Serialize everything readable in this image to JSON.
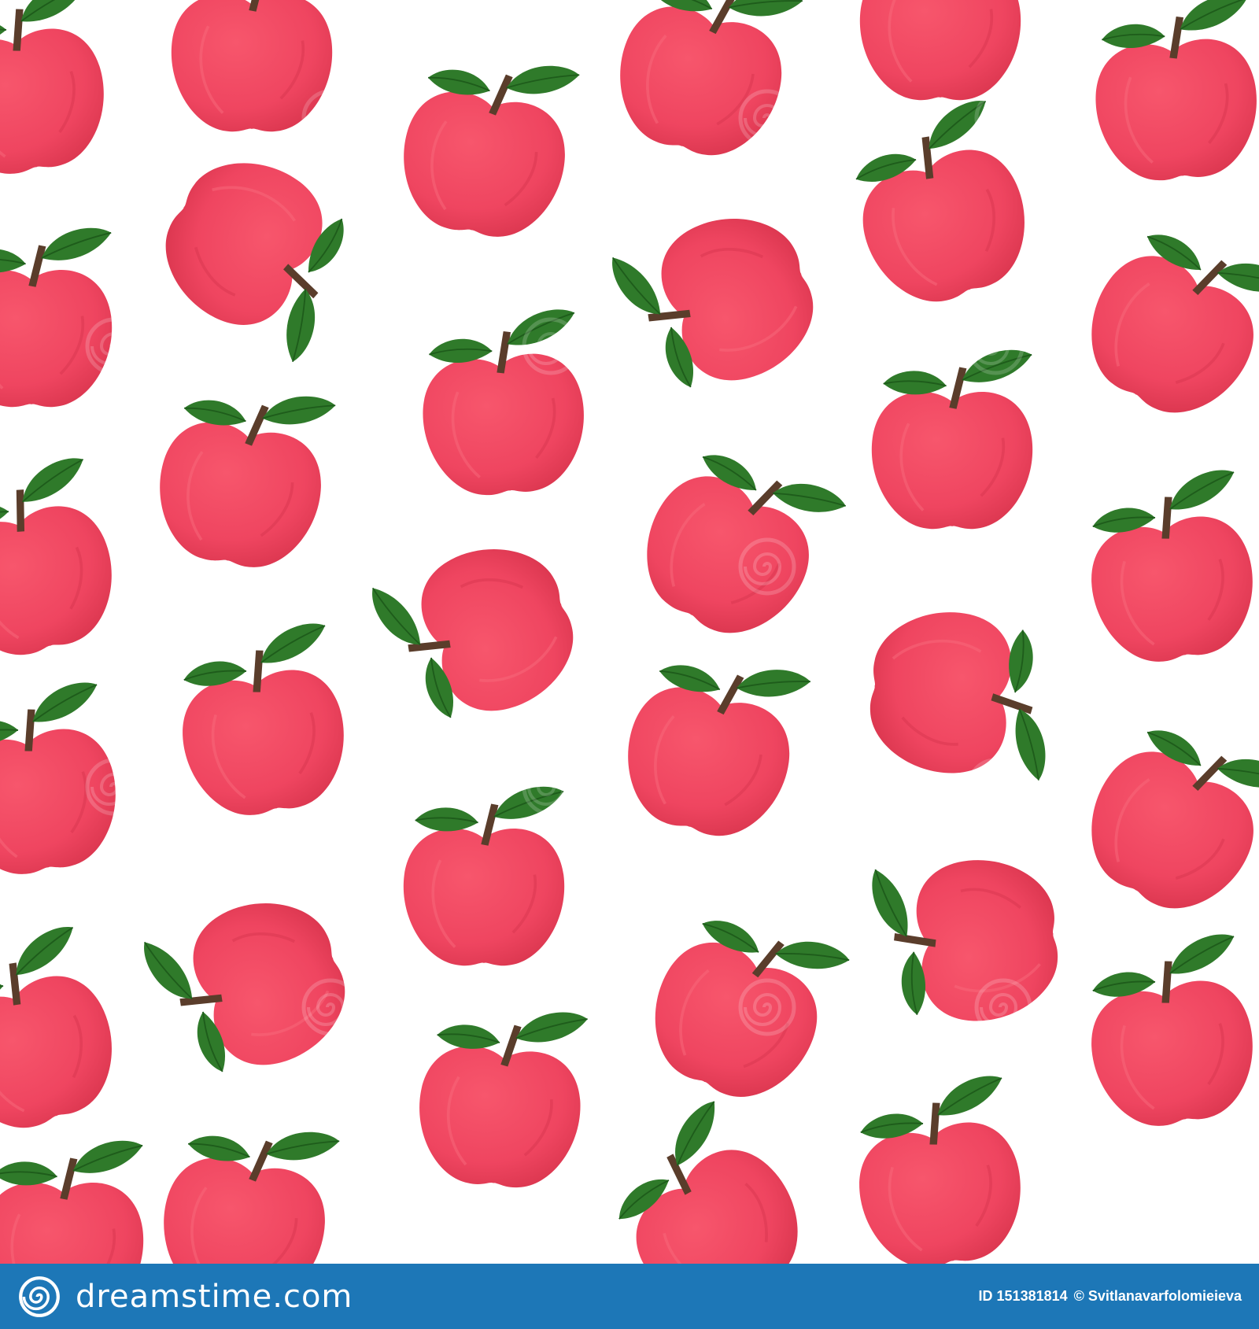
{
  "image": {
    "subject": "seamless pattern of red apples with green leaves",
    "colors": {
      "background": "#ffffff",
      "apple": "#f0465e",
      "apple_shade": "#e23a52",
      "leaf": "#2f7a2a",
      "leaf_dark": "#1e5c1b",
      "stem": "#5a3d2b",
      "footer": "#1d77b7"
    }
  },
  "footer": {
    "brand": "dreamstime.com",
    "id_text": "ID 151381814",
    "author_text": "© Svitlanavarfolomieieva"
  }
}
